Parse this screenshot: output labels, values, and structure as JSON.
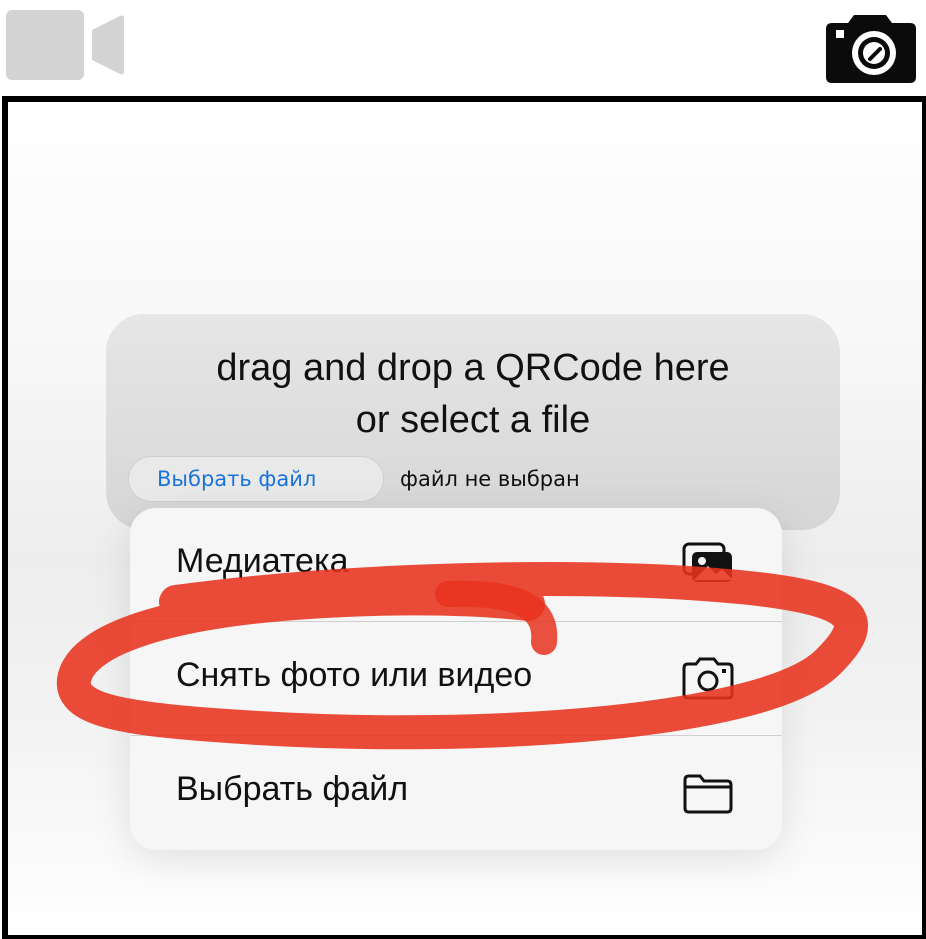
{
  "top_icons": {
    "left": "video-camera-icon",
    "right": "camera-icon"
  },
  "dropzone": {
    "line1": "drag and drop a QRCode here",
    "line2": "or select a file"
  },
  "file_input": {
    "button_label": "Выбрать файл",
    "status": "файл не выбран"
  },
  "menu": {
    "items": [
      {
        "label": "Медиатека",
        "icon": "photo-library-icon"
      },
      {
        "label": "Снять фото или видео",
        "icon": "camera-icon"
      },
      {
        "label": "Выбрать файл",
        "icon": "folder-icon"
      }
    ]
  },
  "colors": {
    "accent_link": "#1a73d9",
    "annotation_red": "#e8321e",
    "frame_border": "#000000",
    "camera_icon": "#0b0b0b",
    "video_icon": "#d0d0d0"
  }
}
